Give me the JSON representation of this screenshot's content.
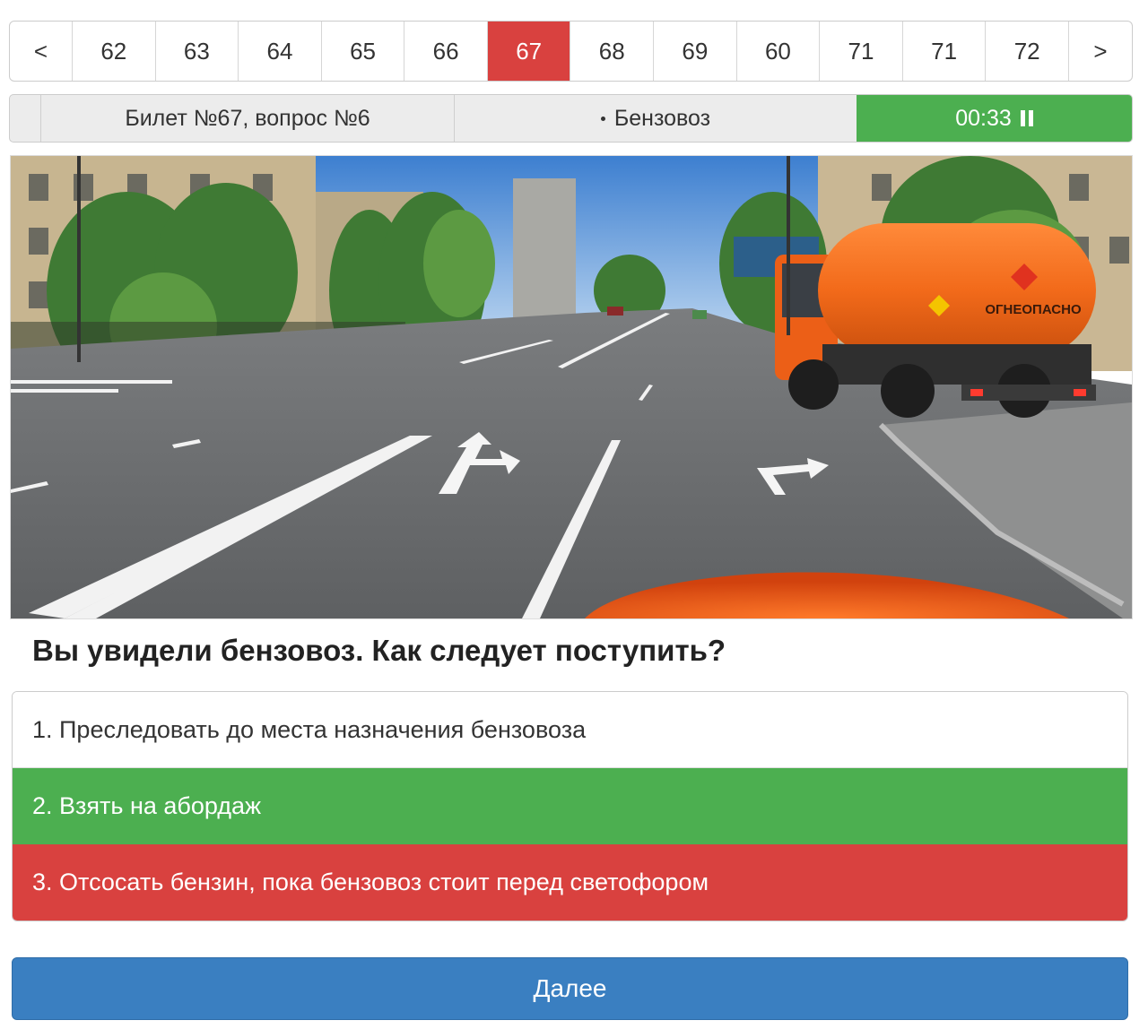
{
  "pager": {
    "prev": "<",
    "next": ">",
    "pages": [
      "62",
      "63",
      "64",
      "65",
      "66",
      "67",
      "68",
      "69",
      "60",
      "71",
      "71",
      "72"
    ],
    "active": "67"
  },
  "info": {
    "ticket": "Билет №67, вопрос №6",
    "topic": "Бензовоз",
    "timer": "00:33",
    "timer_color": "#4caf50"
  },
  "scene": {
    "truck_text": "ОГНЕОПАСНО"
  },
  "question": "Вы увидели бензовоз. Как следует поступить?",
  "answers": [
    {
      "label": "1. Преследовать до места назначения бензовоза",
      "state": "neutral"
    },
    {
      "label": "2. Взять на абордаж",
      "state": "correct"
    },
    {
      "label": "3. Отсосать бензин, пока бензовоз стоит перед светофором",
      "state": "wrong"
    }
  ],
  "next_button": "Далее",
  "colors": {
    "active_page": "#d9413f",
    "correct": "#4caf50",
    "wrong": "#d9413f",
    "primary": "#3a7fc1"
  }
}
